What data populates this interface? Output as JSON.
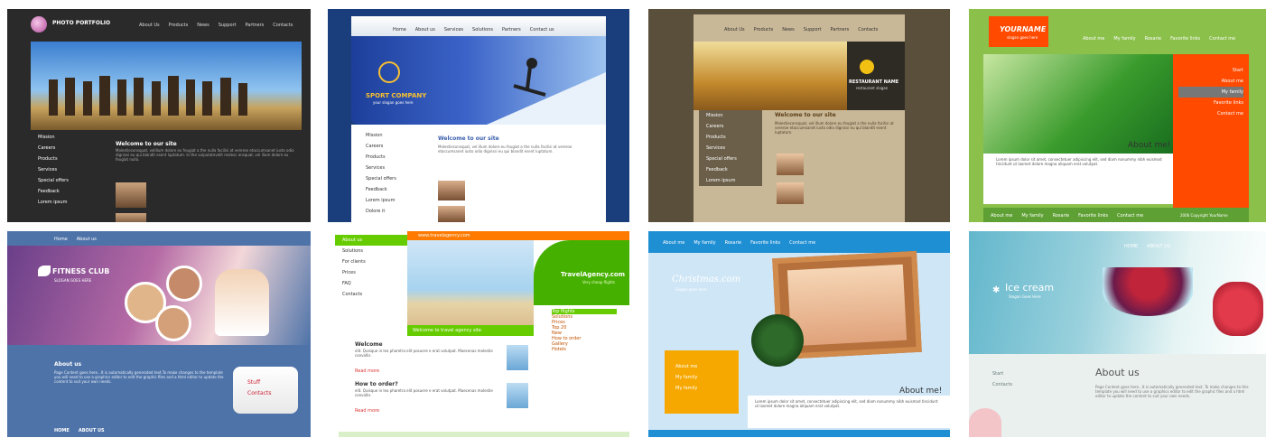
{
  "colors": {
    "t1_bg": "#2a2a2a",
    "t2_bg": "#1a3d7c",
    "t3_bg": "#5a4f3b",
    "t4_bg": "#8bc04b",
    "t4_accent": "#ff4a00",
    "t5_bg": "#4e73a8",
    "t6_accent": "#ff7a00",
    "t6_green": "#66cc00",
    "t7_sky": "#cfe6f6",
    "t8_bg": "#e9f0ee"
  },
  "t1": {
    "logo_title": "PHOTO PORTFOLIO",
    "nav": [
      "About Us",
      "Products",
      "News",
      "Support",
      "Partners",
      "Contacts"
    ],
    "menu": [
      "Mission",
      "Careers",
      "Products",
      "Services",
      "Special offers",
      "Feedback",
      "Lorem ipsum"
    ],
    "welcome": "Welcome to our site",
    "body": "Molestieconsquat, velillum dolore eu feugiat a the nulla facilisi at vereroe etaccumsanet iusto odio dignissi eu qui blandit esent luptatum. In the vulputatevelit molesc onsquat, vel illum dolore eu feugiat nulla."
  },
  "t2": {
    "nav": [
      "Home",
      "About us",
      "Services",
      "Solutions",
      "Partners",
      "Contact us"
    ],
    "brand": "SPORT COMPANY",
    "tagline": "your slogan goes here",
    "menu": [
      "Mission",
      "Careers",
      "Products",
      "Services",
      "Special offers",
      "Feedback",
      "Lorem ipsum",
      "Dolore it"
    ],
    "welcome": "Welcome to our site",
    "body": "Molestieconsquat, vel illum dolore eu feugiat a the nulla facilisi at vereroe etaccumsanet iusto odio dignissi eu qui blandit esent luptatum."
  },
  "t3": {
    "nav": [
      "About Us",
      "Products",
      "News",
      "Support",
      "Partners",
      "Contacts"
    ],
    "name": "RESTAURANT NAME",
    "slogan": "restaurant slogan",
    "menu": [
      "Mission",
      "Careers",
      "Products",
      "Services",
      "Special offers",
      "Feedback",
      "Lorem ipsum"
    ],
    "welcome": "Welcome to our site",
    "body": "Molestieconsquat, vel illum dolore eu feugiat a the nulla facilisi at vereroe etaccumsanet iusto odio dignissi eu qui blandit esent luptatum."
  },
  "t4": {
    "logo": "YOURNAME",
    "logo_sub": "slogan goes here",
    "nav": [
      "About me",
      "My family",
      "Rosarie",
      "Favorite links",
      "Contact me"
    ],
    "side": [
      "Start",
      "About me",
      "My family",
      "Favorite links",
      "Contact me"
    ],
    "heading": "About me!",
    "body": "Lorem ipsum dolor sit amet, consectetuer adipiscing elit, sed diam nonummy nibh euismod tincidunt ut laoreet dolore magna aliquam erat volutpat.",
    "footer_links": [
      "About me",
      "My family",
      "Rosarie",
      "Favorite links",
      "Contact me"
    ],
    "copyright": "2006 Copyright YourName"
  },
  "t5": {
    "nav": [
      "Home",
      "About us"
    ],
    "brand": "FITNESS CLUB",
    "slogan": "SLOGAN GOES HERE",
    "about": "About us",
    "body": "Page Content goes here...It is automatically generated text.To make changes to the template you will need to use a graphics editor to edit the graphic files and a html editor to update the content to suit your own needs.",
    "links": [
      "Stuff",
      "Contacts"
    ],
    "footer": [
      "HOME",
      "ABOUT US"
    ]
  },
  "t6": {
    "menu": [
      "About us",
      "Solutions",
      "For clients",
      "Prices",
      "FAQ",
      "Contacts"
    ],
    "url": "www.travelagency.com",
    "brand": "TravelAgency.com",
    "brand_sub": "Very cheap flights",
    "caption": "Welcome to travel agency site",
    "links": [
      "Top flights",
      "Solutions",
      "Prices",
      "Top 20",
      "New",
      "How to order",
      "Gallery",
      "Hotels"
    ],
    "welcome": "Welcome",
    "body1": "elit. Quisque in leo pharetra elit posuere e erat volutpat. Maecenas molestie convallis",
    "howto": "How to order?",
    "body2": "elit. Quisque in leo pharetra elit posuere e erat volutpat. Maecenas molestie convallis",
    "read_more": "Read more"
  },
  "t7": {
    "nav": [
      "About me",
      "My family",
      "Rosarie",
      "Favorite links",
      "Contact me"
    ],
    "brand": "Christmas.com",
    "slogan": "Slogan goes here",
    "menu": [
      "About me",
      "My family",
      "My family"
    ],
    "heading": "About me!",
    "body": "Lorem ipsum dolor sit amet, consectetuer adipiscing elit, sed diam nonummy nibh euismod tincidunt ut laoreet dolore magna aliquam erat volutpat."
  },
  "t8": {
    "nav": [
      "HOME",
      "ABOUT US"
    ],
    "brand": "Ice cream",
    "slogan": "Slogan Goes Here",
    "menu": [
      "Start",
      "Contacts"
    ],
    "heading": "About us",
    "body": "Page Content goes here...It is automatically generated text. To make changes to this template you will need to use a graphics editor to edit the graphic files and a html editor to update the content to suit your own needs."
  }
}
